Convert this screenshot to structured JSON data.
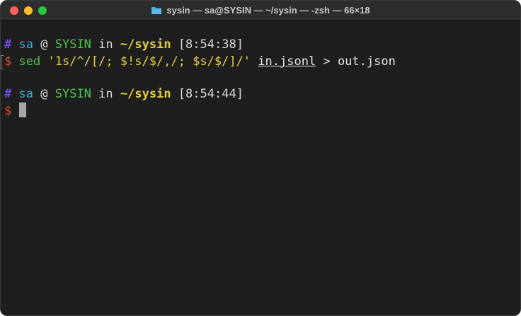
{
  "window": {
    "title": "sysin — sa@SYSIN — ~/sysin — -zsh — 66×18",
    "title_icon": "folder-icon"
  },
  "terminal": {
    "prompts": [
      {
        "hash": "#",
        "user": "sa",
        "at": "@",
        "host": "SYSIN",
        "in": "in",
        "dir": "~/sysin",
        "time": "[8:54:38]"
      },
      {
        "hash": "#",
        "user": "sa",
        "at": "@",
        "host": "SYSIN",
        "in": "in",
        "dir": "~/sysin",
        "time": "[8:54:44]"
      }
    ],
    "command": {
      "dollar": "$",
      "cmd": "sed",
      "arg": "'1s/^/[/; $!s/$/,/; $s/$/]/'",
      "input_file": "in.jsonl",
      "redirect": ">",
      "output_file": "out.json"
    },
    "current_prompt": {
      "dollar": "$"
    }
  },
  "colors": {
    "background": "#1e1e1e",
    "hash": "#6f4ce8",
    "user": "#3aa8d0",
    "host": "#4ec24e",
    "dir": "#e2cf42",
    "dollar": "#e04a34"
  }
}
